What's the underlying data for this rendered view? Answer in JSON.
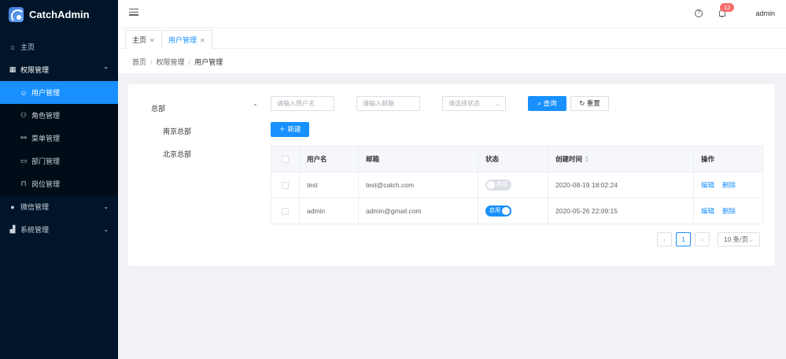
{
  "app": {
    "title": "CatchAdmin"
  },
  "sidebar": {
    "items": [
      {
        "label": "主页",
        "icon": "home-icon"
      },
      {
        "label": "权限管理",
        "icon": "grid-icon",
        "open": true,
        "children": [
          {
            "label": "用户管理",
            "icon": "user-icon",
            "active": true
          },
          {
            "label": "角色管理",
            "icon": "users-icon"
          },
          {
            "label": "菜单管理",
            "icon": "link-icon"
          },
          {
            "label": "部门管理",
            "icon": "monitor-icon"
          },
          {
            "label": "岗位管理",
            "icon": "briefcase-icon"
          }
        ]
      },
      {
        "label": "微信管理",
        "icon": "wechat-icon"
      },
      {
        "label": "系统管理",
        "icon": "chart-icon"
      }
    ]
  },
  "header": {
    "notifications": "12",
    "user": "admin"
  },
  "tags": [
    {
      "label": "主页",
      "active": false
    },
    {
      "label": "用户管理",
      "active": true
    }
  ],
  "breadcrumb": [
    "首页",
    "权限管理",
    "用户管理"
  ],
  "tree": {
    "root": "总部",
    "children": [
      "南京总部",
      "北京总部"
    ]
  },
  "filters": {
    "username_placeholder": "请输入用户名",
    "email_placeholder": "请输入邮箱",
    "status_placeholder": "请选择状态",
    "search_label": "查询",
    "reset_label": "重置"
  },
  "create_label": "新建",
  "table": {
    "columns": [
      "用户名",
      "邮箱",
      "状态",
      "创建时间",
      "操作"
    ],
    "rows": [
      {
        "username": "test",
        "email": "test@catch.com",
        "status_label": "禁用",
        "enabled": false,
        "created": "2020-08-19 18:02:24"
      },
      {
        "username": "admin",
        "email": "admin@gmail.com",
        "status_label": "启用",
        "enabled": true,
        "created": "2020-05-26 22:09:15"
      }
    ],
    "actions": {
      "edit": "编辑",
      "delete": "删除"
    }
  },
  "pagination": {
    "current": "1",
    "page_size": "10 条/页"
  },
  "colors": {
    "primary": "#1890ff",
    "sidebar_bg": "#001529",
    "badge": "#f56c6c"
  }
}
